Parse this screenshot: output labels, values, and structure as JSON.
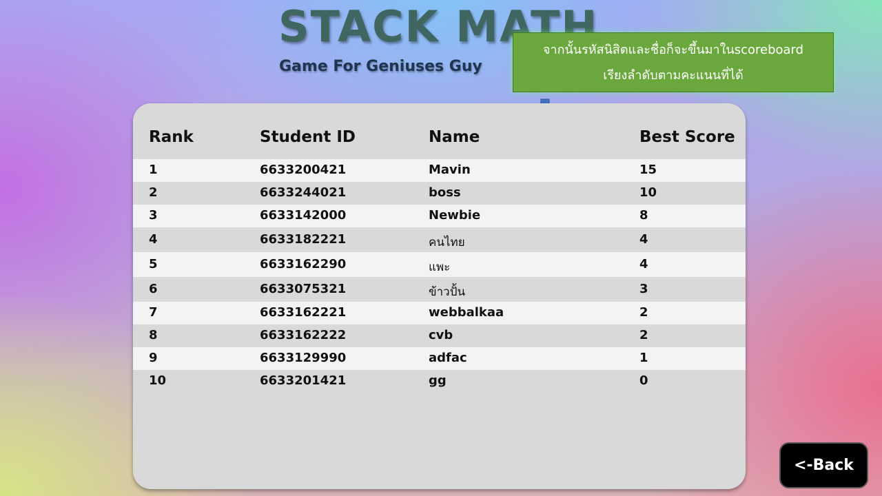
{
  "header": {
    "title": "STACK MATH",
    "subtitle": "Game For Geniuses Guy"
  },
  "annotation": {
    "line1": "จากนั้นรหัสนิสิตและชื่อก็จะขึ้นมาในscoreboard",
    "line2": "เรียงลำดับตามคะแนนที่ได้",
    "box_color": "#6aa83e",
    "arrow_color": "#4472c4",
    "arrow_icon": "arrow-down-icon"
  },
  "scoreboard": {
    "columns": {
      "rank": "Rank",
      "student_id": "Student ID",
      "name": "Name",
      "best_score": "Best Score"
    },
    "rows": [
      {
        "rank": "1",
        "student_id": "6633200421",
        "name": "Mavin",
        "best_score": "15"
      },
      {
        "rank": "2",
        "student_id": "6633244021",
        "name": "boss",
        "best_score": "10"
      },
      {
        "rank": "3",
        "student_id": "6633142000",
        "name": "Newbie",
        "best_score": "8"
      },
      {
        "rank": "4",
        "student_id": "6633182221",
        "name": "คนไทย",
        "best_score": "4"
      },
      {
        "rank": "5",
        "student_id": "6633162290",
        "name": "แพะ",
        "best_score": "4"
      },
      {
        "rank": "6",
        "student_id": "6633075321",
        "name": "ข้าวปั้น",
        "best_score": "3"
      },
      {
        "rank": "7",
        "student_id": "6633162221",
        "name": "webbalkaa",
        "best_score": "2"
      },
      {
        "rank": "8",
        "student_id": "6633162222",
        "name": "cvb",
        "best_score": "2"
      },
      {
        "rank": "9",
        "student_id": "6633129990",
        "name": "adfac",
        "best_score": "1"
      },
      {
        "rank": "10",
        "student_id": "6633201421",
        "name": "gg",
        "best_score": "0"
      }
    ]
  },
  "back_button": {
    "label": "<-Back"
  }
}
